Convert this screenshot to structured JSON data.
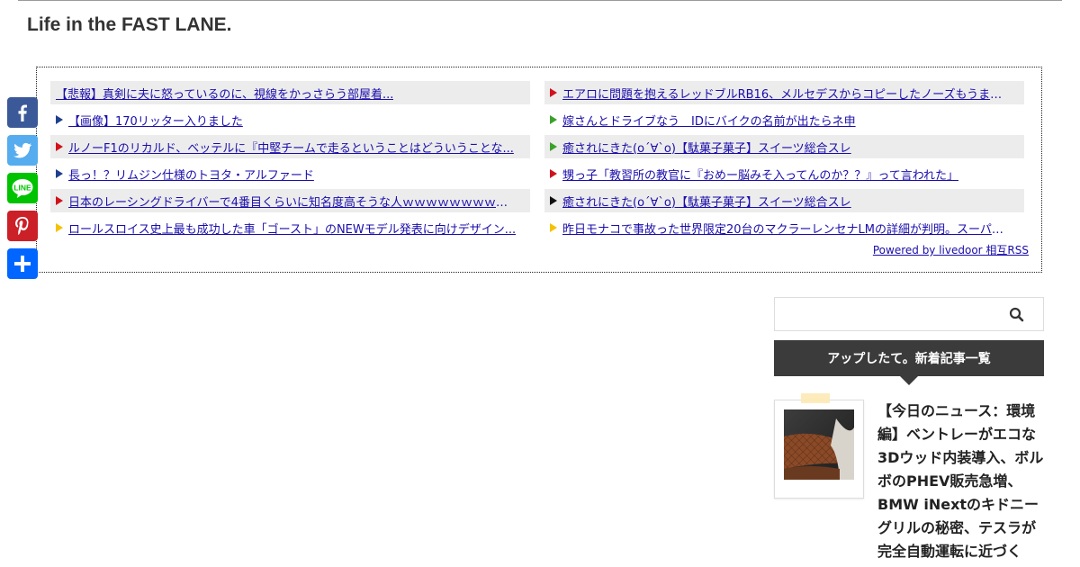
{
  "site": {
    "title": "Life in the FAST LANE."
  },
  "rss": {
    "left": [
      {
        "text": "【悲報】真剣に夫に怒っているのに、視線をかっさらう部屋着...",
        "marker_color": ""
      },
      {
        "text": "【画像】170リッター入りました",
        "marker_color": "#1f3f8f"
      },
      {
        "text": "ルノーF1のリカルド、ベッテルに『中堅チームで走るということはどういうことな...",
        "marker_color": "#d0121b"
      },
      {
        "text": "長っ！？リムジン仕様のトヨタ・アルファード",
        "marker_color": "#1f3f8f"
      },
      {
        "text": "日本のレーシングドライバーで4番目くらいに知名度高そうな人ｗｗｗｗｗｗｗｗｗｗ",
        "marker_color": "#d0121b"
      },
      {
        "text": "ロールスロイス史上最も成功した車「ゴースト」のNEWモデル発表に向けデザイン...",
        "marker_color": "#f5c200"
      }
    ],
    "right": [
      {
        "text": "エアロに問題を抱えるレッドブルRB16、メルセデスからコピーしたノーズもうまく...",
        "marker_color": "#d0121b"
      },
      {
        "text": "嫁さんとドライブなう　IDにバイクの名前が出たらネ申",
        "marker_color": "#3aa12a"
      },
      {
        "text": "癒されにきた(o´∀`o)【駄菓子菓子】スイーツ総合スレ",
        "marker_color": "#3aa12a"
      },
      {
        "text": "甥っ子「教習所の教官に『おめー脳みそ入ってんのか？？』って言われた」",
        "marker_color": "#d0121b"
      },
      {
        "text": "癒されにきた(o´∀`o)【駄菓子菓子】スイーツ総合スレ",
        "marker_color": "#111111"
      },
      {
        "text": "昨日モナコで事故った世界限定20台のマクラーレンセナLMの詳細が判明。スーパー...",
        "marker_color": "#f5c200"
      }
    ],
    "powered_by": "Powered by livedoor 相互RSS"
  },
  "share": [
    {
      "service": "Facebook",
      "icon": "facebook-icon",
      "color": "#3b5998"
    },
    {
      "service": "Twitter",
      "icon": "twitter-icon",
      "color": "#55acee"
    },
    {
      "service": "Line",
      "icon": "line-icon",
      "color": "#00c300"
    },
    {
      "service": "Pinterest",
      "icon": "pinterest-icon",
      "color": "#cb2027"
    },
    {
      "service": "Share",
      "icon": "plus-share-icon",
      "color": "#0166ff"
    }
  ],
  "search": {
    "placeholder": "",
    "icon": "search-icon"
  },
  "widget": {
    "heading": "アップしたて。新着記事一覧",
    "post_title": "【今日のニュース：環境編】ベントレーがエコな3Dウッド内装導入、ボルボのPHEV販売急増、BMW iNextのキドニーグリルの秘密、テスラが完全自動運転に近づく"
  }
}
